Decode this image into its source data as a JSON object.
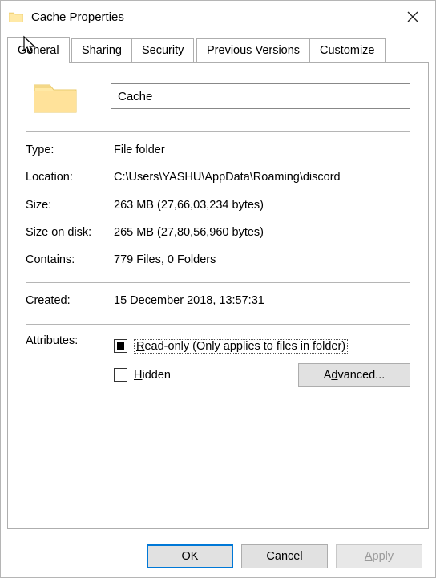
{
  "window": {
    "title": "Cache Properties"
  },
  "tabs": {
    "general": "General",
    "sharing": "Sharing",
    "security": "Security",
    "previous": "Previous Versions",
    "customize": "Customize"
  },
  "name_field": {
    "value": "Cache"
  },
  "labels": {
    "type": "Type:",
    "location": "Location:",
    "size": "Size:",
    "size_on_disk": "Size on disk:",
    "contains": "Contains:",
    "created": "Created:",
    "attributes": "Attributes:"
  },
  "values": {
    "type": "File folder",
    "location": "C:\\Users\\YASHU\\AppData\\Roaming\\discord",
    "size": "263 MB (27,66,03,234 bytes)",
    "size_on_disk": "265 MB (27,80,56,960 bytes)",
    "contains": "779 Files, 0 Folders",
    "created": "15 December 2018, 13:57:31"
  },
  "attributes": {
    "readonly_prefix": "R",
    "readonly_rest": "ead-only (Only applies to files in folder)",
    "hidden_prefix": "H",
    "hidden_rest": "idden",
    "advanced_prefix": "A",
    "advanced_mid": "d",
    "advanced_rest": "vanced..."
  },
  "buttons": {
    "ok": "OK",
    "cancel": "Cancel",
    "apply_prefix": "A",
    "apply_rest": "pply"
  }
}
